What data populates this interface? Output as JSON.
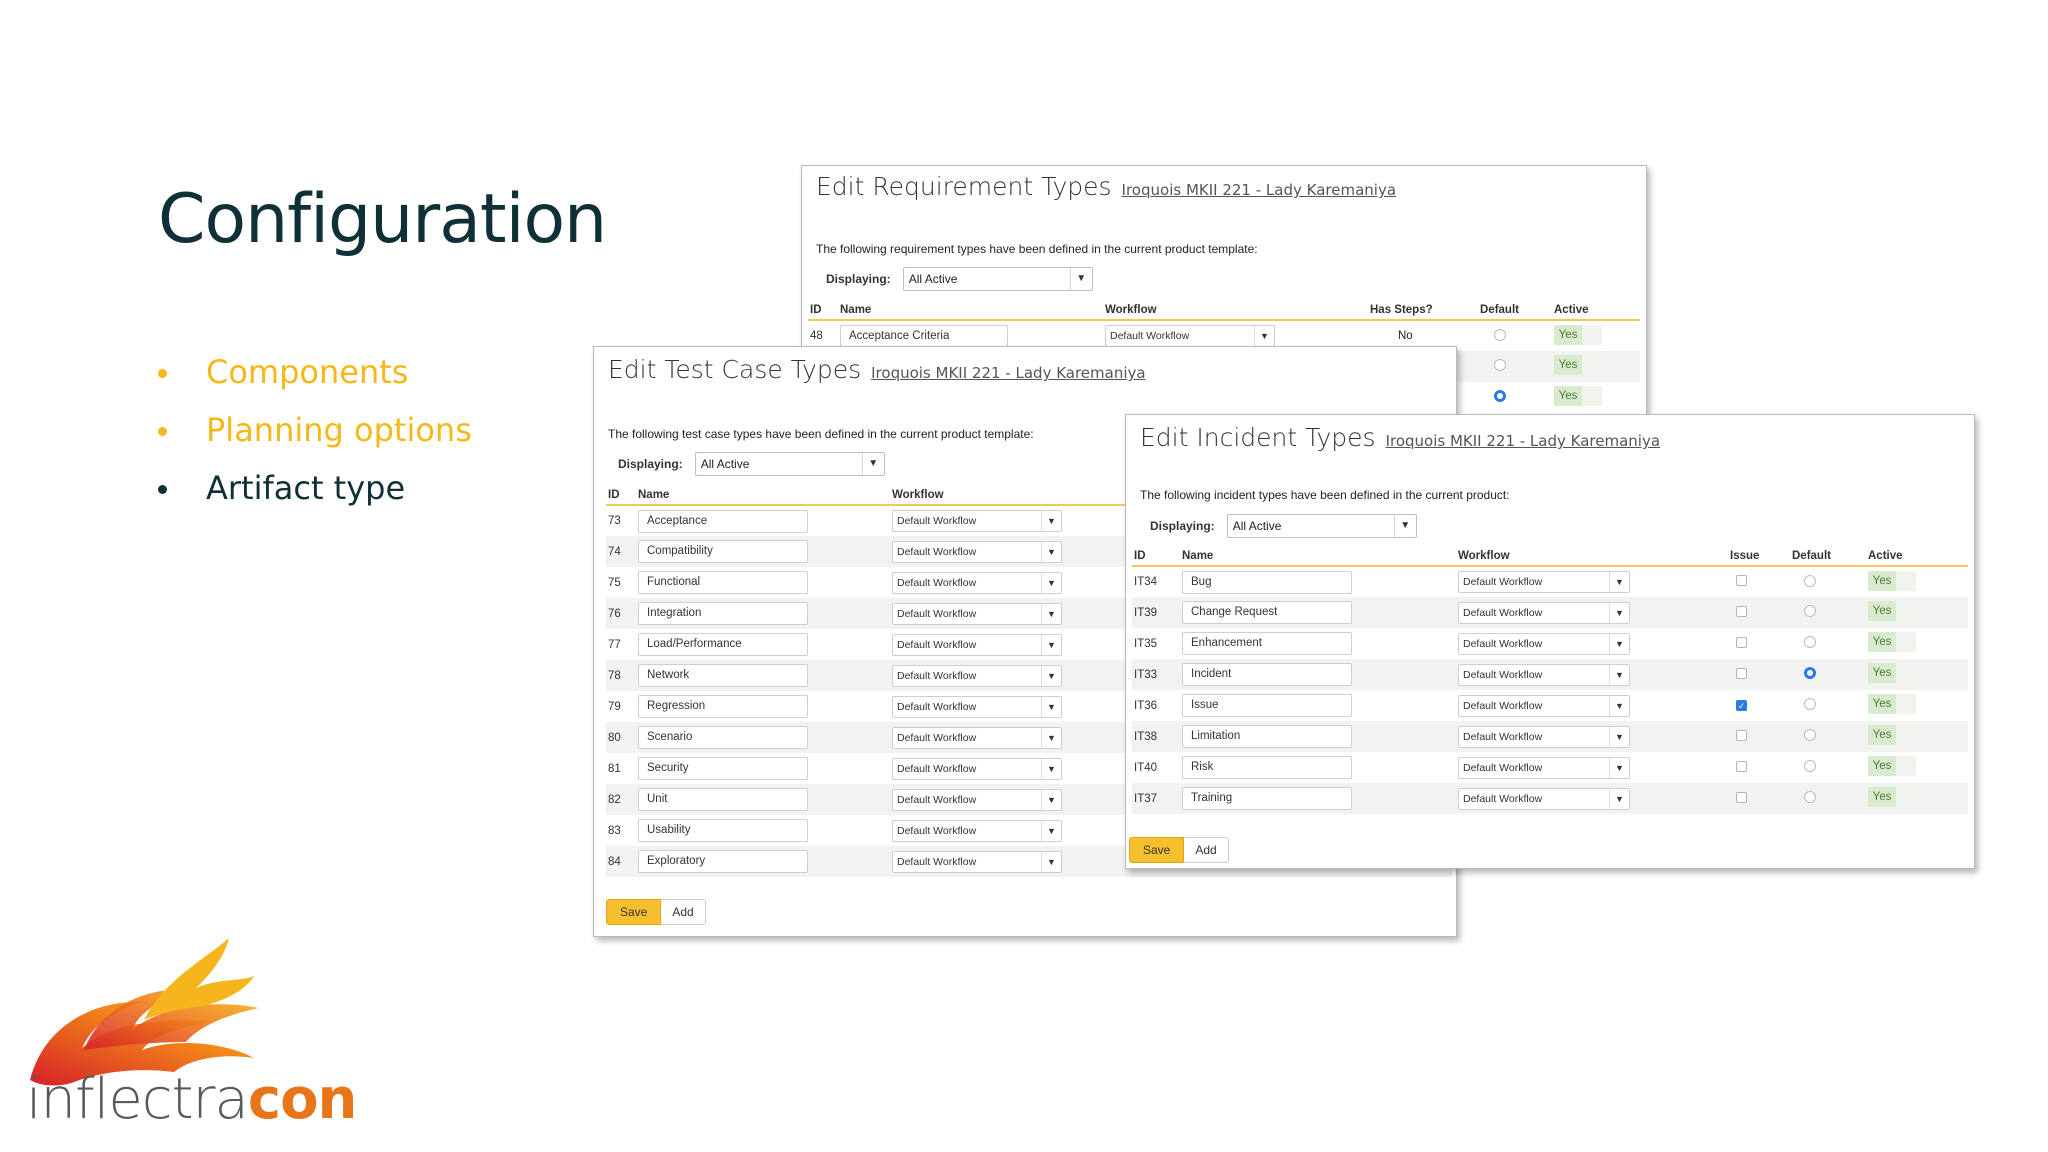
{
  "slide": {
    "title": "Configuration",
    "bullets": [
      "Components",
      "Planning options",
      "Artifact type"
    ]
  },
  "logo": {
    "part1": "inflectra",
    "part2": "con"
  },
  "colors": {
    "accent": "#f5b819",
    "title": "#0f3037",
    "logo_orange": "#e8751a",
    "yes_green": "#4d7a35",
    "radio_blue": "#2a7be4"
  },
  "req": {
    "title": "Edit Requirement Types",
    "link": "Iroquois MKII 221 - Lady Karemaniya",
    "desc": "The following requirement types have been defined in the current product template:",
    "displaying_label": "Displaying:",
    "displaying_value": "All Active",
    "headers": [
      "ID",
      "Name",
      "Workflow",
      "Has Steps?",
      "Default",
      "Active"
    ],
    "row": {
      "id": "48",
      "name": "Acceptance Criteria",
      "workflow": "Default Workflow",
      "has_steps": "No"
    },
    "active_labels": [
      "Yes",
      "Yes",
      "Yes"
    ]
  },
  "tc": {
    "title": "Edit Test Case Types",
    "link": "Iroquois MKII 221 - Lady Karemaniya",
    "desc": "The following test case types have been defined in the current product template:",
    "displaying_label": "Displaying:",
    "displaying_value": "All Active",
    "headers": [
      "ID",
      "Name",
      "Workflow"
    ],
    "rows": [
      {
        "id": "73",
        "name": "Acceptance",
        "workflow": "Default Workflow"
      },
      {
        "id": "74",
        "name": "Compatibility",
        "workflow": "Default Workflow"
      },
      {
        "id": "75",
        "name": "Functional",
        "workflow": "Default Workflow"
      },
      {
        "id": "76",
        "name": "Integration",
        "workflow": "Default Workflow"
      },
      {
        "id": "77",
        "name": "Load/Performance",
        "workflow": "Default Workflow"
      },
      {
        "id": "78",
        "name": "Network",
        "workflow": "Default Workflow"
      },
      {
        "id": "79",
        "name": "Regression",
        "workflow": "Default Workflow"
      },
      {
        "id": "80",
        "name": "Scenario",
        "workflow": "Default Workflow"
      },
      {
        "id": "81",
        "name": "Security",
        "workflow": "Default Workflow"
      },
      {
        "id": "82",
        "name": "Unit",
        "workflow": "Default Workflow"
      },
      {
        "id": "83",
        "name": "Usability",
        "workflow": "Default Workflow"
      },
      {
        "id": "84",
        "name": "Exploratory",
        "workflow": "Default Workflow"
      }
    ],
    "save": "Save",
    "add": "Add"
  },
  "inc": {
    "title": "Edit Incident Types",
    "link": "Iroquois MKII 221 - Lady Karemaniya",
    "desc": "The following incident types have been defined in the current product:",
    "displaying_label": "Displaying:",
    "displaying_value": "All Active",
    "headers": [
      "ID",
      "Name",
      "Workflow",
      "Issue",
      "Default",
      "Active"
    ],
    "rows": [
      {
        "id": "IT34",
        "name": "Bug",
        "workflow": "Default Workflow",
        "issue": false,
        "default": false,
        "active": "Yes"
      },
      {
        "id": "IT39",
        "name": "Change Request",
        "workflow": "Default Workflow",
        "issue": false,
        "default": false,
        "active": "Yes"
      },
      {
        "id": "IT35",
        "name": "Enhancement",
        "workflow": "Default Workflow",
        "issue": false,
        "default": false,
        "active": "Yes"
      },
      {
        "id": "IT33",
        "name": "Incident",
        "workflow": "Default Workflow",
        "issue": false,
        "default": true,
        "active": "Yes"
      },
      {
        "id": "IT36",
        "name": "Issue",
        "workflow": "Default Workflow",
        "issue": true,
        "default": false,
        "active": "Yes"
      },
      {
        "id": "IT38",
        "name": "Limitation",
        "workflow": "Default Workflow",
        "issue": false,
        "default": false,
        "active": "Yes"
      },
      {
        "id": "IT40",
        "name": "Risk",
        "workflow": "Default Workflow",
        "issue": false,
        "default": false,
        "active": "Yes"
      },
      {
        "id": "IT37",
        "name": "Training",
        "workflow": "Default Workflow",
        "issue": false,
        "default": false,
        "active": "Yes"
      }
    ],
    "save": "Save",
    "add": "Add"
  }
}
